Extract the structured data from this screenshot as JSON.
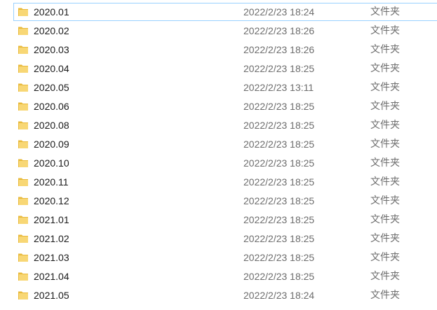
{
  "colors": {
    "folder_back": "#e8b93a",
    "folder_front": "#f8d775",
    "selection_border": "#99d1ff",
    "name_text": "#1a1a1a",
    "meta_text": "#6d6d6d"
  },
  "rows": [
    {
      "name": "2020.01",
      "date": "2022/2/23 18:24",
      "type": "文件夹",
      "icon": "folder-icon",
      "selected": true
    },
    {
      "name": "2020.02",
      "date": "2022/2/23 18:26",
      "type": "文件夹",
      "icon": "folder-icon"
    },
    {
      "name": "2020.03",
      "date": "2022/2/23 18:26",
      "type": "文件夹",
      "icon": "folder-icon"
    },
    {
      "name": "2020.04",
      "date": "2022/2/23 18:25",
      "type": "文件夹",
      "icon": "folder-icon"
    },
    {
      "name": "2020.05",
      "date": "2022/2/23 13:11",
      "type": "文件夹",
      "icon": "folder-icon"
    },
    {
      "name": "2020.06",
      "date": "2022/2/23 18:25",
      "type": "文件夹",
      "icon": "folder-icon"
    },
    {
      "name": "2020.08",
      "date": "2022/2/23 18:25",
      "type": "文件夹",
      "icon": "folder-icon"
    },
    {
      "name": "2020.09",
      "date": "2022/2/23 18:25",
      "type": "文件夹",
      "icon": "folder-icon"
    },
    {
      "name": "2020.10",
      "date": "2022/2/23 18:25",
      "type": "文件夹",
      "icon": "folder-icon"
    },
    {
      "name": "2020.11",
      "date": "2022/2/23 18:25",
      "type": "文件夹",
      "icon": "folder-icon"
    },
    {
      "name": "2020.12",
      "date": "2022/2/23 18:25",
      "type": "文件夹",
      "icon": "folder-icon"
    },
    {
      "name": "2021.01",
      "date": "2022/2/23 18:25",
      "type": "文件夹",
      "icon": "folder-icon"
    },
    {
      "name": "2021.02",
      "date": "2022/2/23 18:25",
      "type": "文件夹",
      "icon": "folder-icon"
    },
    {
      "name": "2021.03",
      "date": "2022/2/23 18:25",
      "type": "文件夹",
      "icon": "folder-icon"
    },
    {
      "name": "2021.04",
      "date": "2022/2/23 18:25",
      "type": "文件夹",
      "icon": "folder-icon"
    },
    {
      "name": "2021.05",
      "date": "2022/2/23 18:24",
      "type": "文件夹",
      "icon": "folder-icon"
    }
  ]
}
